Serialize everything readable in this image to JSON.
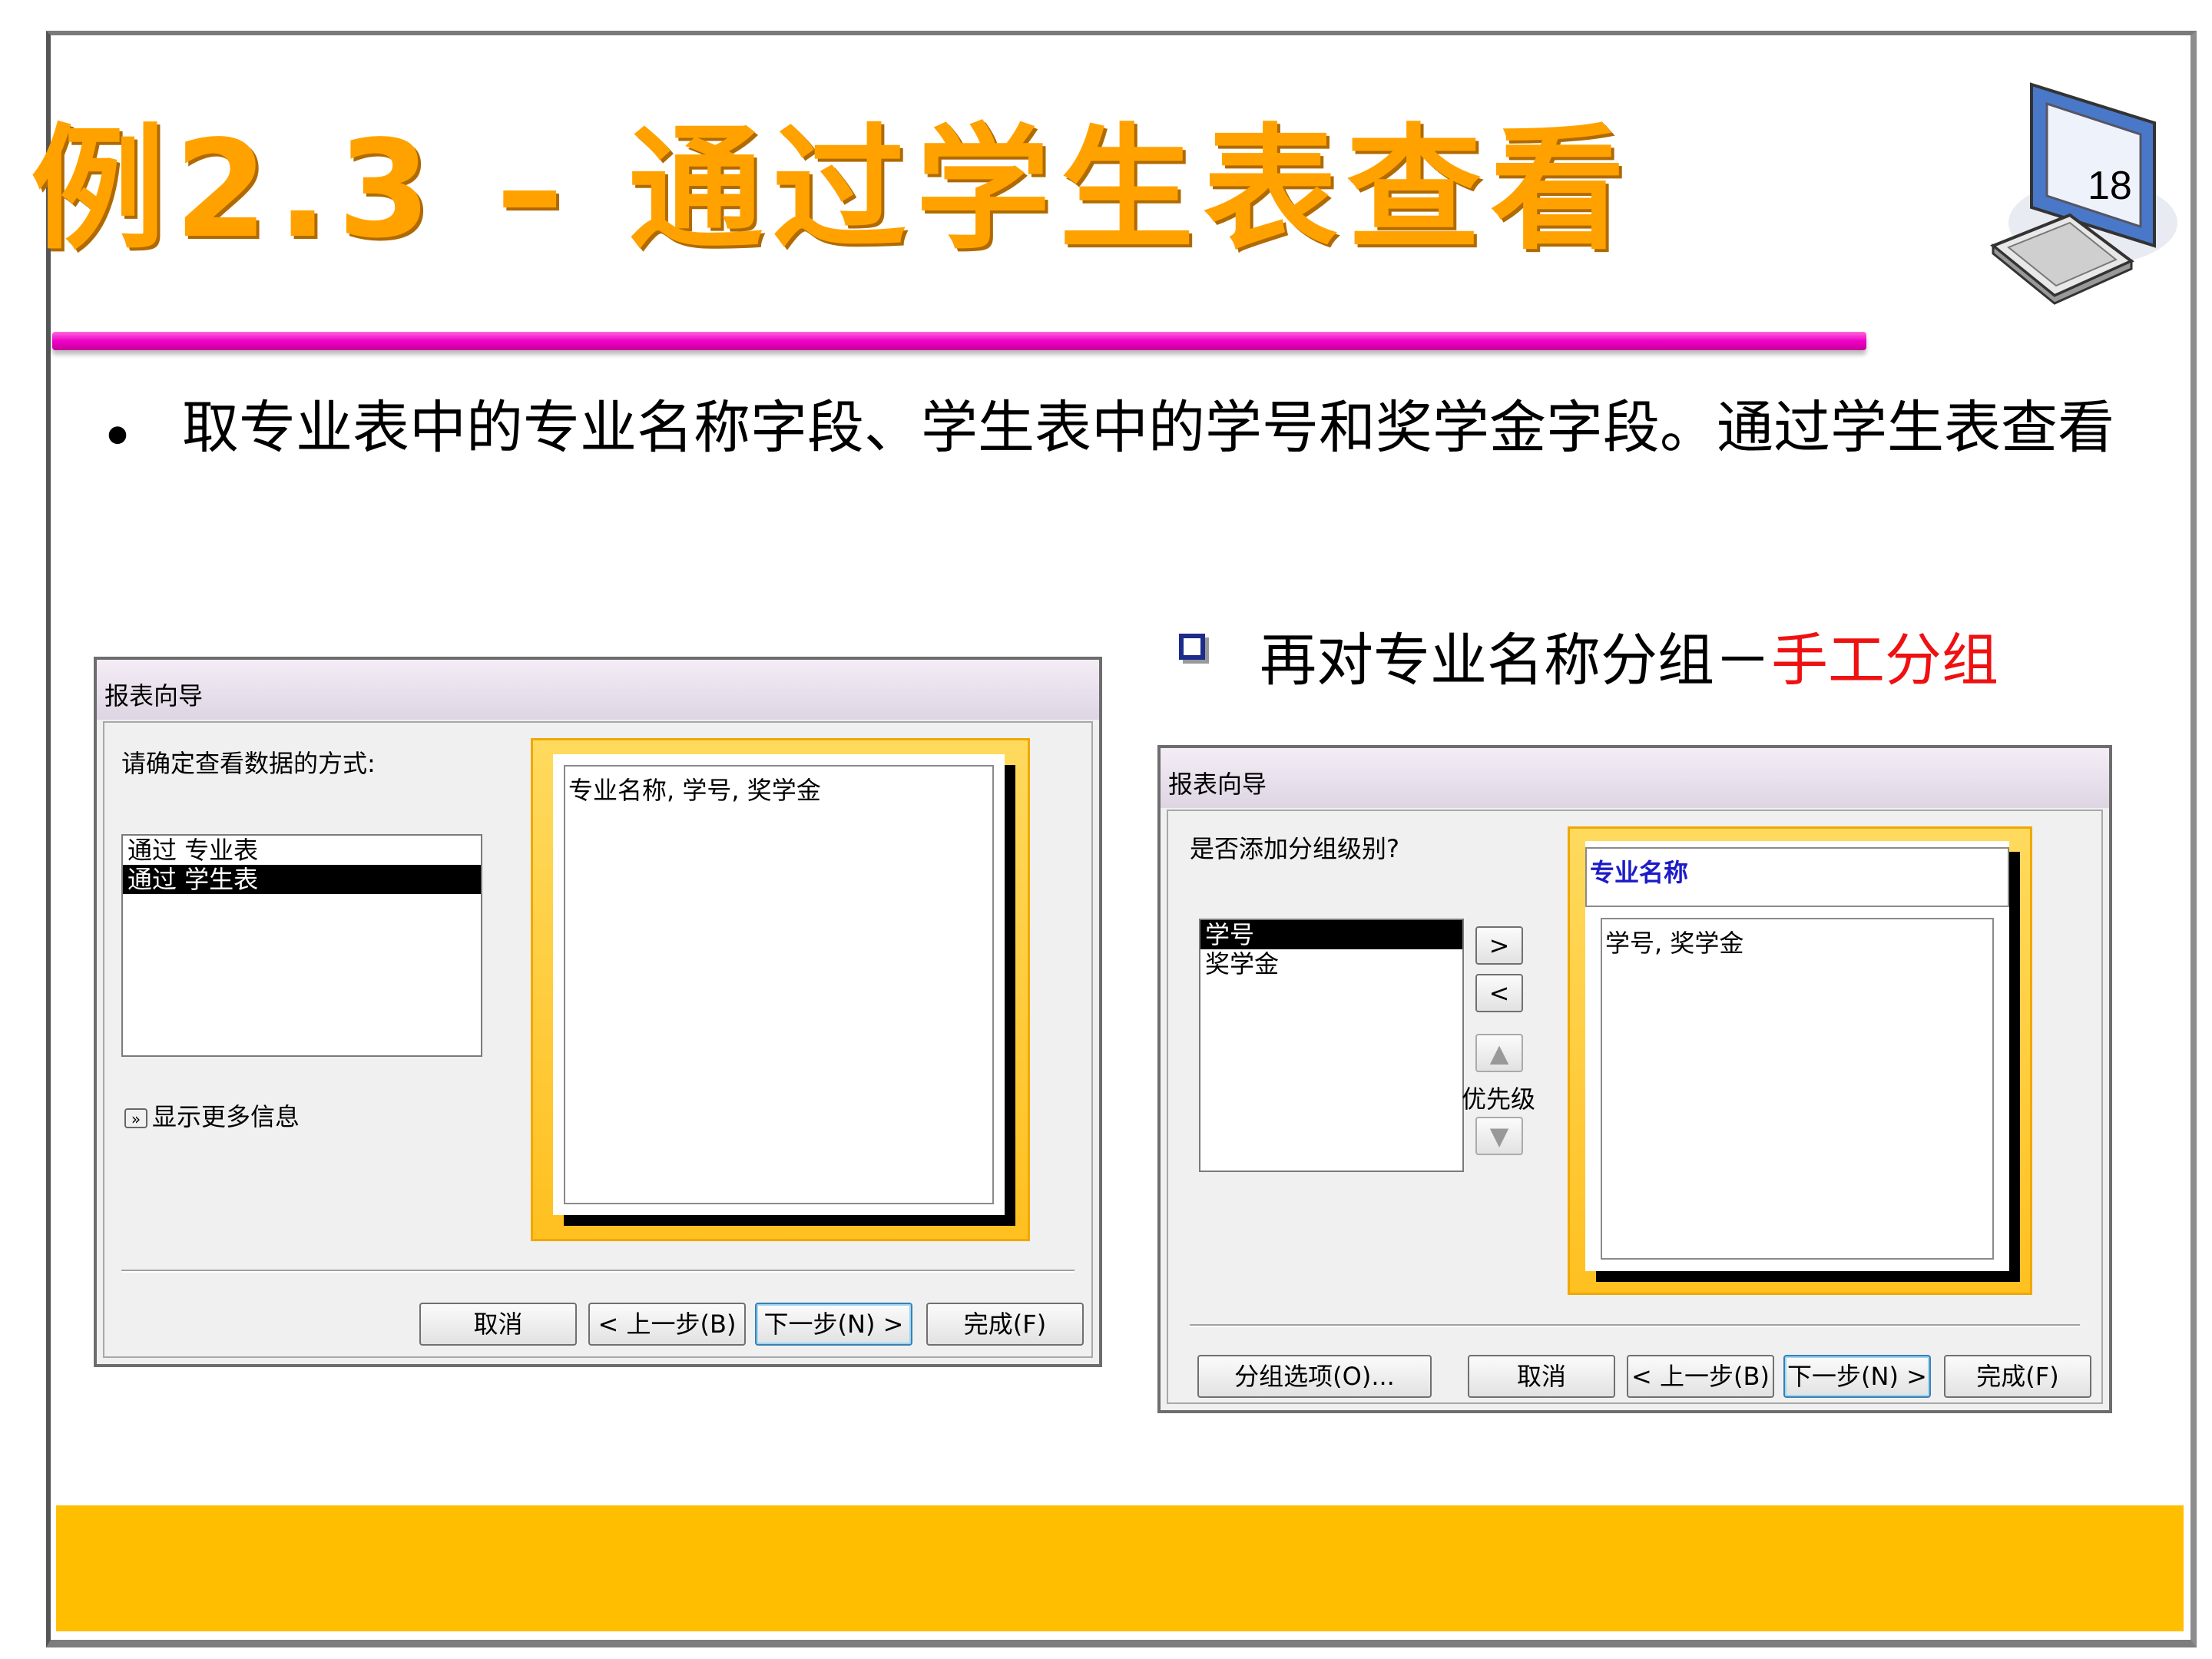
{
  "slide": {
    "title": "例2.3 – 通过学生表查看",
    "page_number": "18",
    "bullet_text": "取专业表中的专业名称字段、学生表中的学号和奖学金字段。通过学生表查看",
    "sub_bullet_prefix": "再对专业名称分组－",
    "sub_bullet_highlight": "手工分组",
    "colors": {
      "title": "#ffa200",
      "highlight": "#ee1111",
      "pink_bar": "#ee00c8",
      "band": "#ffbe00"
    }
  },
  "dialog1": {
    "title": "报表向导",
    "prompt": "请确定查看数据的方式:",
    "options": [
      "通过 专业表",
      "通过 学生表"
    ],
    "selected_option": "通过 学生表",
    "show_more": "显示更多信息",
    "preview_text": "专业名称, 学号, 奖学金",
    "buttons": {
      "cancel": "取消",
      "back": "< 上一步(B)",
      "next": "下一步(N) >",
      "finish": "完成(F)"
    }
  },
  "dialog2": {
    "title": "报表向导",
    "prompt": "是否添加分组级别?",
    "fields": [
      "学号",
      "奖学金"
    ],
    "selected_field": "学号",
    "add_button": ">",
    "remove_button": "<",
    "priority_label": "优先级",
    "group_header": "专业名称",
    "detail_text": "学号, 奖学金",
    "buttons": {
      "group_options": "分组选项(O)...",
      "cancel": "取消",
      "back": "< 上一步(B)",
      "next": "下一步(N) >",
      "finish": "完成(F)"
    }
  }
}
